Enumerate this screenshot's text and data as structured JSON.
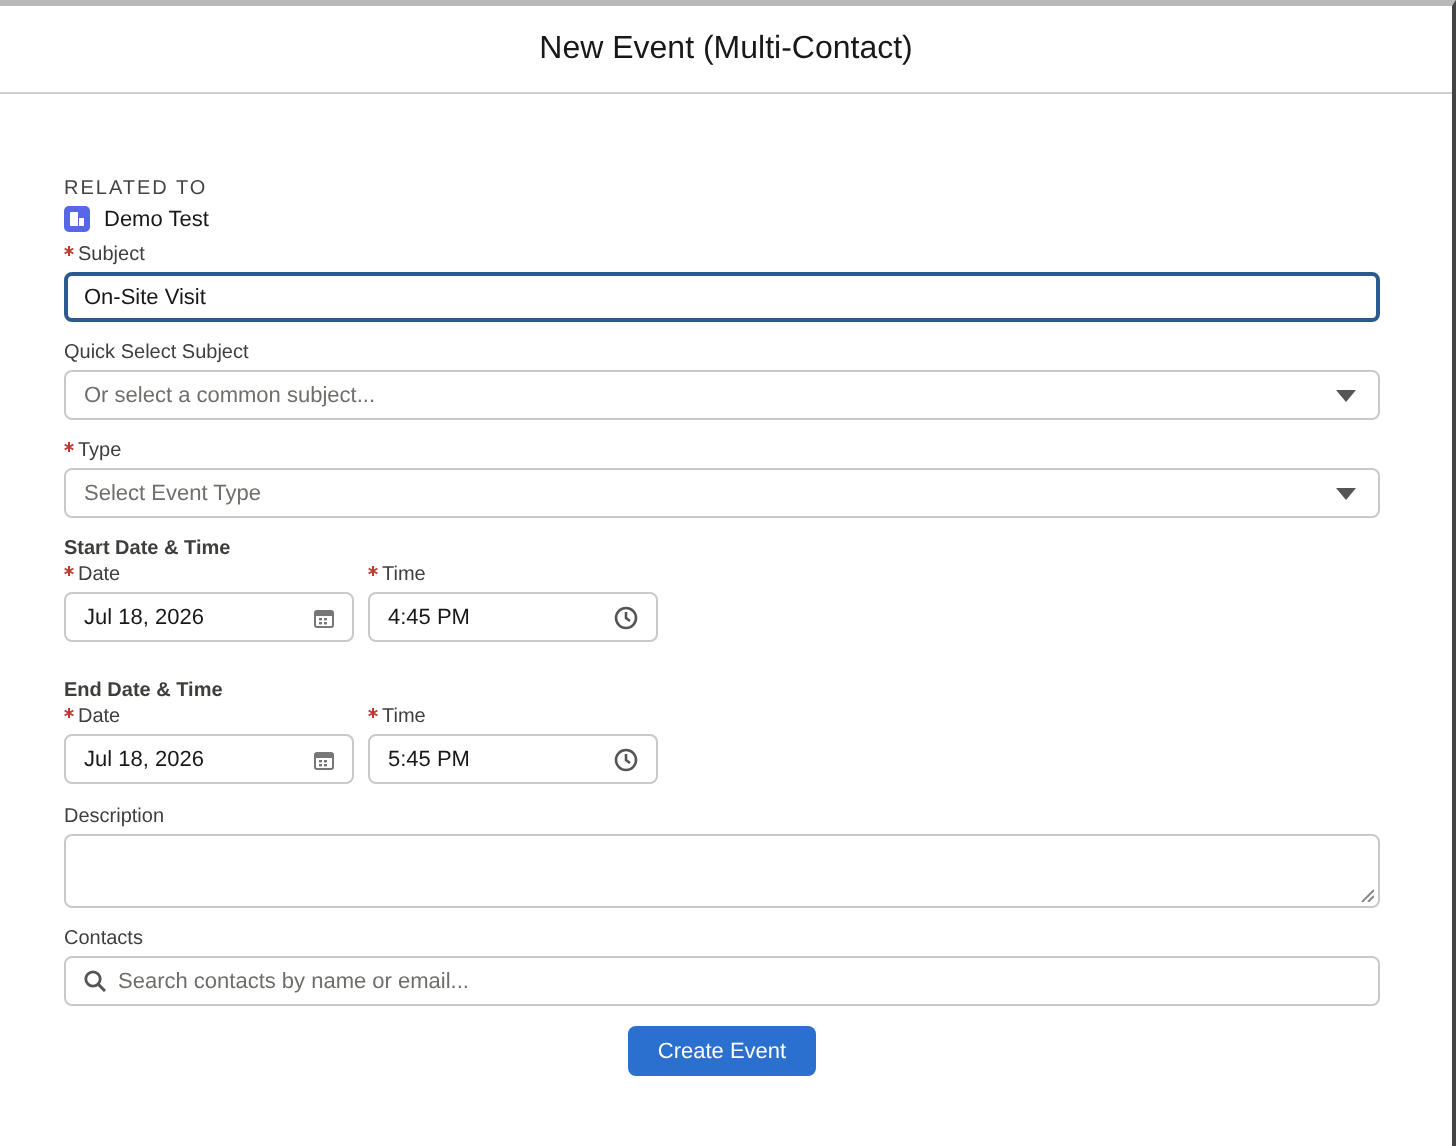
{
  "modal": {
    "title": "New Event (Multi-Contact)"
  },
  "related_to": {
    "label": "RELATED TO",
    "record": "Demo Test"
  },
  "fields": [
    {
      "kind": "text",
      "label": "Subject",
      "required": true,
      "value": "On-Site Visit",
      "focused": true
    },
    {
      "kind": "select",
      "label": "Quick Select Subject",
      "required": false,
      "placeholder": "Or select a common subject...",
      "focused": false
    },
    {
      "kind": "select",
      "label": "Type",
      "required": true,
      "placeholder": "Select Event Type",
      "focused": false
    }
  ],
  "datetime_groups": [
    {
      "heading": "Start Date & Time",
      "date": {
        "label": "Date",
        "required": true,
        "value": "Jul 18, 2026"
      },
      "time": {
        "label": "Time",
        "required": true,
        "value": "4:45 PM"
      }
    },
    {
      "heading": "End Date & Time",
      "date": {
        "label": "Date",
        "required": true,
        "value": "Jul 18, 2026"
      },
      "time": {
        "label": "Time",
        "required": true,
        "value": "5:45 PM"
      }
    }
  ],
  "description": {
    "label": "Description"
  },
  "contacts": {
    "label": "Contacts",
    "placeholder": "Search contacts by name or email..."
  },
  "submit_button": "Create Event"
}
